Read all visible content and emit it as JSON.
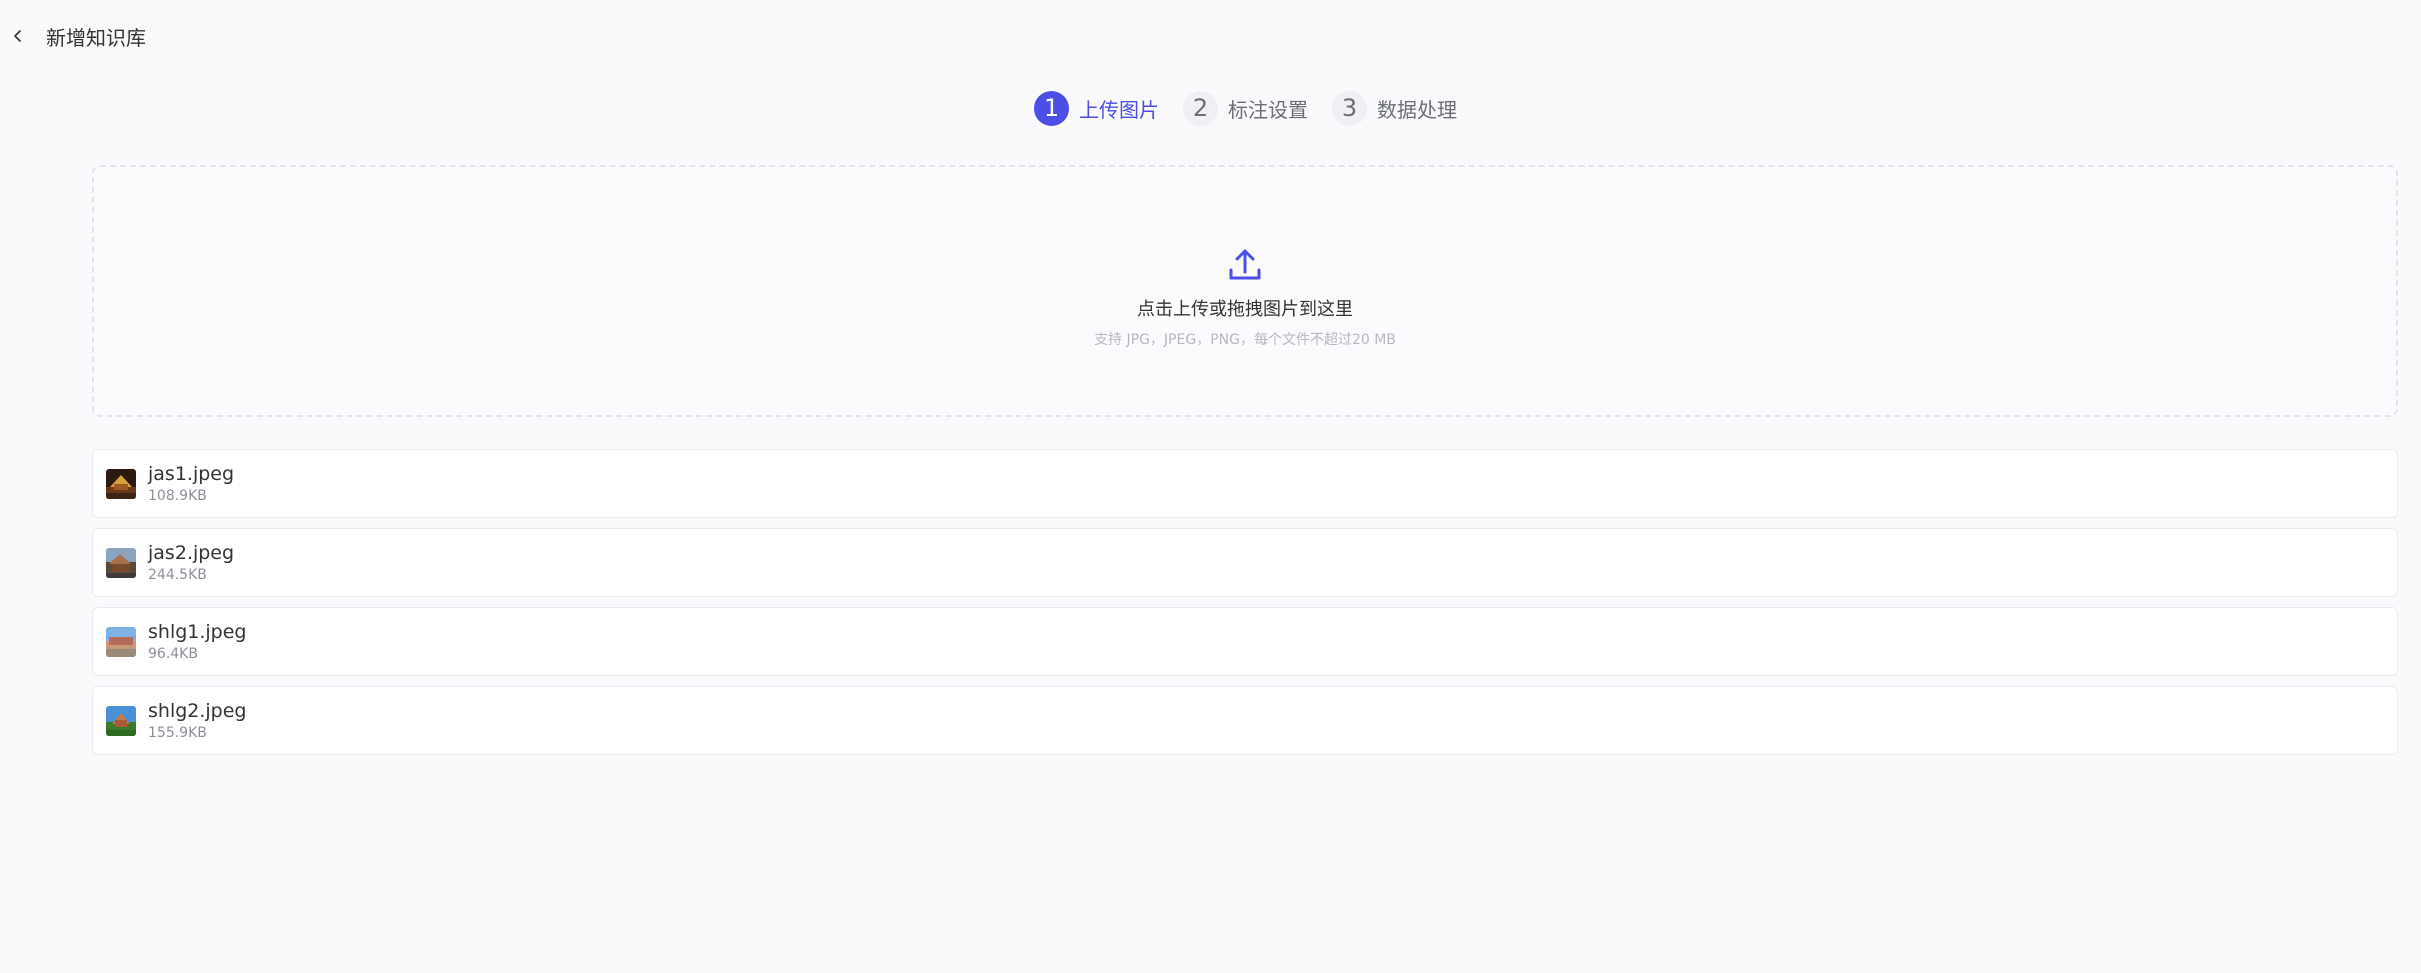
{
  "header": {
    "title": "新增知识库",
    "back_icon": "chevron-left-icon"
  },
  "steps": [
    {
      "number": "1",
      "label": "上传图片",
      "active": true
    },
    {
      "number": "2",
      "label": "标注设置",
      "active": false
    },
    {
      "number": "3",
      "label": "数据处理",
      "active": false
    }
  ],
  "upload": {
    "icon": "upload-icon",
    "text": "点击上传或拖拽图片到这里",
    "hint": "支持 JPG，JPEG，PNG，每个文件不超过20 MB"
  },
  "files": [
    {
      "name": "jas1.jpeg",
      "size": "108.9KB"
    },
    {
      "name": "jas2.jpeg",
      "size": "244.5KB"
    },
    {
      "name": "shlg1.jpeg",
      "size": "96.4KB"
    },
    {
      "name": "shlg2.jpeg",
      "size": "155.9KB"
    }
  ],
  "colors": {
    "accent": "#4c4ee6",
    "background": "#fafafc",
    "muted_text": "#8c8f99"
  }
}
